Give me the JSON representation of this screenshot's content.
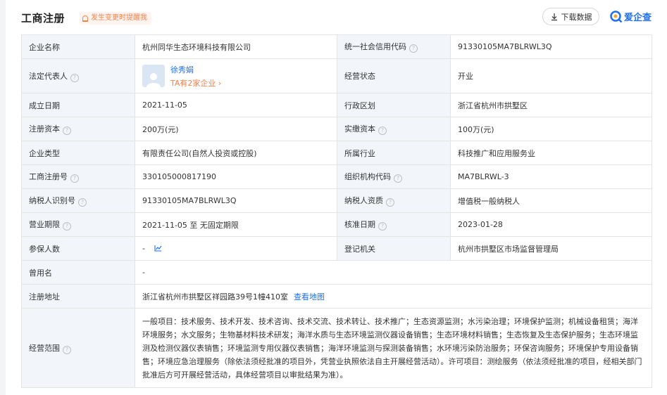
{
  "header": {
    "title": "工商注册",
    "remind_label": "发生变更时提醒我",
    "download_label": "下载数据",
    "brand_name": "爱企查"
  },
  "colors": {
    "accent": "#1f6ff0",
    "orange": "#f5814a",
    "label_bg": "#f2f6fb"
  },
  "rows": {
    "company_name": {
      "label": "企业名称",
      "value": "杭州同华生态环境科技有限公司"
    },
    "credit_code": {
      "label": "统一社会信用代码",
      "value": "91330105MA7BLRWL3Q"
    },
    "legal_rep": {
      "label": "法定代表人",
      "name": "徐秀娟",
      "sub": "TA有2家企业 ›"
    },
    "status": {
      "label": "经营状态",
      "value": "开业"
    },
    "founded": {
      "label": "成立日期",
      "value": "2021-11-05"
    },
    "region": {
      "label": "行政区划",
      "value": "浙江省杭州市拱墅区"
    },
    "reg_capital": {
      "label": "注册资本",
      "value": "200万(元)"
    },
    "paid_capital": {
      "label": "实缴资本",
      "value": "100万(元)"
    },
    "type": {
      "label": "企业类型",
      "value": "有限责任公司(自然人投资或控股)"
    },
    "industry": {
      "label": "所属行业",
      "value": "科技推广和应用服务业"
    },
    "reg_no": {
      "label": "工商注册号",
      "value": "330105000817190"
    },
    "org_code": {
      "label": "组织机构代码",
      "value": "MA7BLRWL-3"
    },
    "taxpayer_id": {
      "label": "纳税人识别号",
      "value": "91330105MA7BLRWL3Q"
    },
    "taxpayer_qual": {
      "label": "纳税人资质",
      "value": "增值税一般纳税人"
    },
    "term": {
      "label": "营业期限",
      "value": "2021-11-05 至 无固定期限"
    },
    "approved": {
      "label": "核准日期",
      "value": "2023-01-28"
    },
    "insured": {
      "label": "参保人数",
      "value": "-"
    },
    "authority": {
      "label": "登记机关",
      "value": "杭州市拱墅区市场监督管理局"
    },
    "former_name": {
      "label": "曾用名",
      "value": "-"
    },
    "address": {
      "label": "注册地址",
      "value": "浙江省杭州市拱墅区祥园路39号1幢410室",
      "link": "查看地图"
    },
    "scope": {
      "label": "经营范围",
      "value": "一般项目：技术服务、技术开发、技术咨询、技术交流、技术转让、技术推广；生态资源监测；水污染治理；环境保护监测；机械设备租赁；海洋环境服务；水文服务；生物基材料技术研发；海洋水质与生态环境监测仪器设备销售；生态环境材料销售；生态恢复及生态保护服务；生态环境监测及检测仪器仪表销售；环境监测专用仪器仪表销售；海洋环境监测与探测装备销售；水环境污染防治服务；环保咨询服务；环境保护专用设备销售；环境应急治理服务（除依法须经批准的项目外，凭营业执照依法自主开展经营活动）。许可项目：测绘服务（依法须经批准的项目，经相关部门批准后方可开展经营活动，具体经营项目以审批结果为准）。"
    }
  }
}
